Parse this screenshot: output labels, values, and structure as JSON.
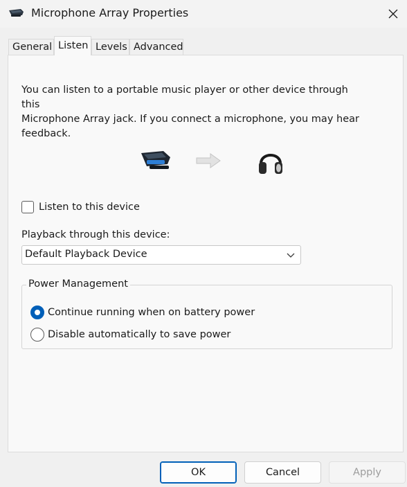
{
  "window": {
    "title": "Microphone Array Properties",
    "close_icon": "close-icon"
  },
  "tabs": [
    {
      "label": "General"
    },
    {
      "label": "Listen",
      "active": true
    },
    {
      "label": "Levels"
    },
    {
      "label": "Advanced"
    }
  ],
  "listen": {
    "description_line1": "You can listen to a portable music player or other device through this",
    "description_line2": "Microphone Array jack.  If you connect a microphone, you may hear",
    "description_line3": "feedback.",
    "listen_checkbox_label": "Listen to this device",
    "listen_checked": false,
    "playback_label": "Playback through this device:",
    "playback_value": "Default Playback Device"
  },
  "power": {
    "group_title": "Power Management",
    "option_continue": "Continue running when on battery power",
    "option_disable": "Disable automatically to save power",
    "selected": "continue"
  },
  "buttons": {
    "ok": "OK",
    "cancel": "Cancel",
    "apply": "Apply"
  },
  "colors": {
    "accent": "#005fb8"
  }
}
